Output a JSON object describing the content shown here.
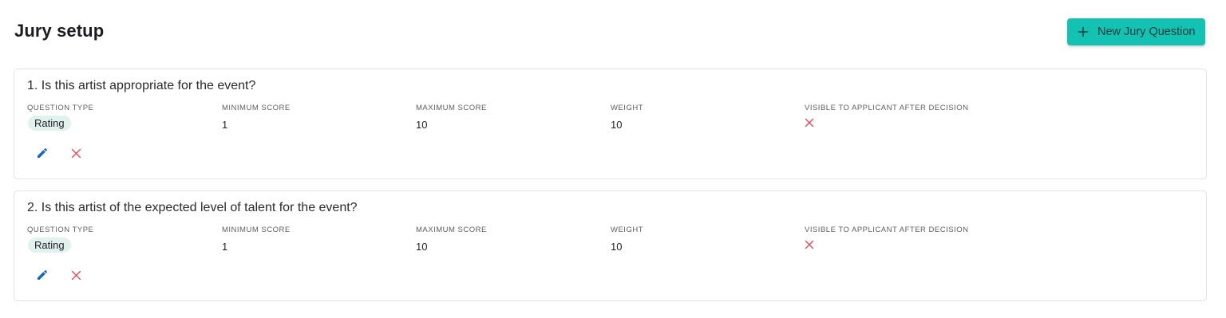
{
  "header": {
    "title": "Jury setup",
    "new_button_label": "New Jury Question"
  },
  "labels": {
    "question_type": "QUESTION TYPE",
    "minimum_score": "MINIMUM SCORE",
    "maximum_score": "MAXIMUM SCORE",
    "weight": "WEIGHT",
    "visible": "VISIBLE TO APPLICANT AFTER DECISION"
  },
  "questions": [
    {
      "title": "1. Is this artist appropriate for the event?",
      "type": "Rating",
      "min_score": "1",
      "max_score": "10",
      "weight": "10",
      "visible": false
    },
    {
      "title": "2. Is this artist of the expected level of talent for the event?",
      "type": "Rating",
      "min_score": "1",
      "max_score": "10",
      "weight": "10",
      "visible": false
    }
  ],
  "colors": {
    "accent": "#14c2b4",
    "badge_bg": "#e0f1ee",
    "edit_icon": "#1565c0",
    "delete_icon": "#e5485b"
  },
  "icons": {
    "add": "plus-icon",
    "edit": "pencil-icon",
    "delete": "close-icon",
    "not_visible": "close-icon"
  }
}
